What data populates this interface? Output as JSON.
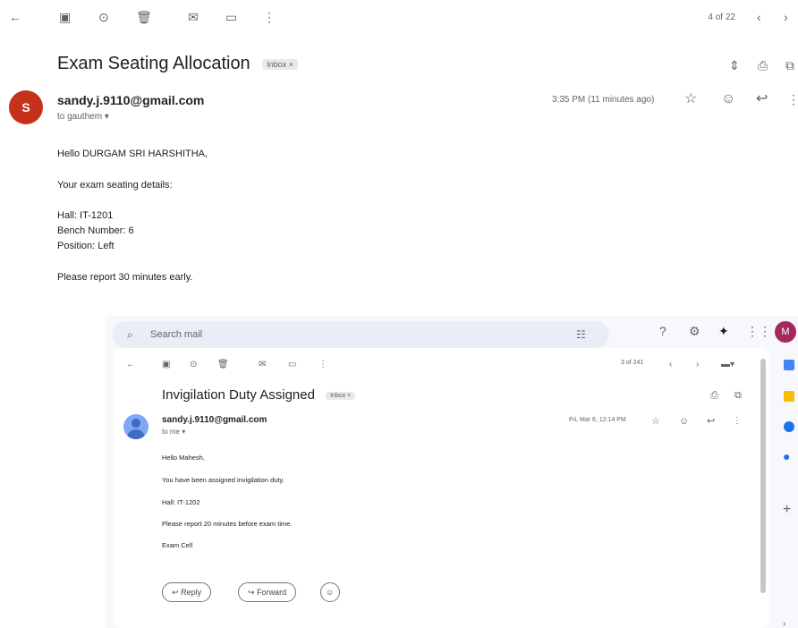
{
  "top_email": {
    "counter": "4 of 22",
    "subject": "Exam Seating Allocation",
    "label": "Inbox",
    "avatar_letter": "S",
    "sender": "sandy.j.9110@gmail.com",
    "to": "to gauthem",
    "time": "3:35 PM (11 minutes ago)",
    "body": [
      "Hello DURGAM SRI HARSHITHA,",
      "Your exam seating details:",
      "Hall: IT-1201",
      "Bench Number: 6",
      "Position: Left",
      "Please report 30 minutes early."
    ]
  },
  "inner": {
    "search_placeholder": "Search mail",
    "profile_letter": "M",
    "counter": "3 of 241",
    "subject": "Invigilation Duty Assigned",
    "label": "Inbox",
    "sender": "sandy.j.9110@gmail.com",
    "to": "to me",
    "time": "Fri, Mar 6, 12:14 PM",
    "body": [
      "Hello Mahesh,",
      "You have been assigned invigilation duty.",
      "Hall: IT-1202",
      "Please report 20 minutes before exam time.",
      "Exam Cell"
    ],
    "reply_label": "Reply",
    "forward_label": "Forward"
  },
  "colors": {
    "avatar_top": "#c5311a",
    "avatar_inner": "#7ea7f5",
    "search_bg": "#e9eef6",
    "profile_bg": "#a6285e"
  }
}
